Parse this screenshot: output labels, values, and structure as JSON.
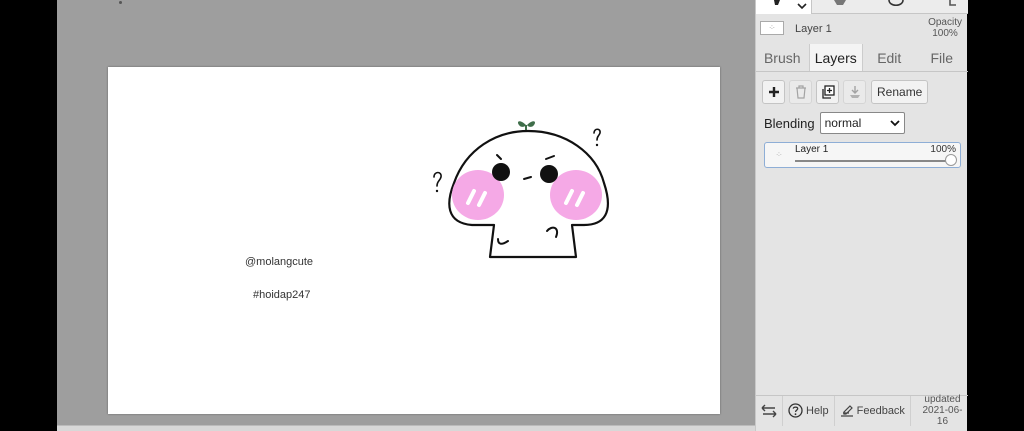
{
  "canvas": {
    "handle_text": "@molangcute",
    "hashtag_text": "#hoidap247"
  },
  "panel": {
    "current_layer": {
      "name": "Layer 1",
      "thumb_label": "·:·"
    },
    "opacity": {
      "label": "Opacity",
      "value": "100%"
    },
    "tabs": [
      {
        "label": "Brush",
        "active": false
      },
      {
        "label": "Layers",
        "active": true
      },
      {
        "label": "Edit",
        "active": false
      },
      {
        "label": "File",
        "active": false
      }
    ],
    "layer_tools": {
      "add_icon": "plus-icon",
      "delete_icon": "trash-icon",
      "duplicate_icon": "duplicate-icon",
      "merge_icon": "merge-down-icon",
      "rename_label": "Rename"
    },
    "blending": {
      "label": "Blending",
      "value": "normal"
    },
    "layer_list": [
      {
        "name": "Layer 1",
        "opacity_text": "100%",
        "opacity": 1.0,
        "thumb_label": "·:·"
      }
    ],
    "footer": {
      "help_label": "Help",
      "feedback_label": "Feedback",
      "updated_label": "updated",
      "updated_date": "2021-06-16"
    }
  },
  "colors": {
    "workspace": "#9e9e9e",
    "panel": "#e4e4e4",
    "blush": "#f5a9e6",
    "sprout": "#3f6e4a"
  }
}
